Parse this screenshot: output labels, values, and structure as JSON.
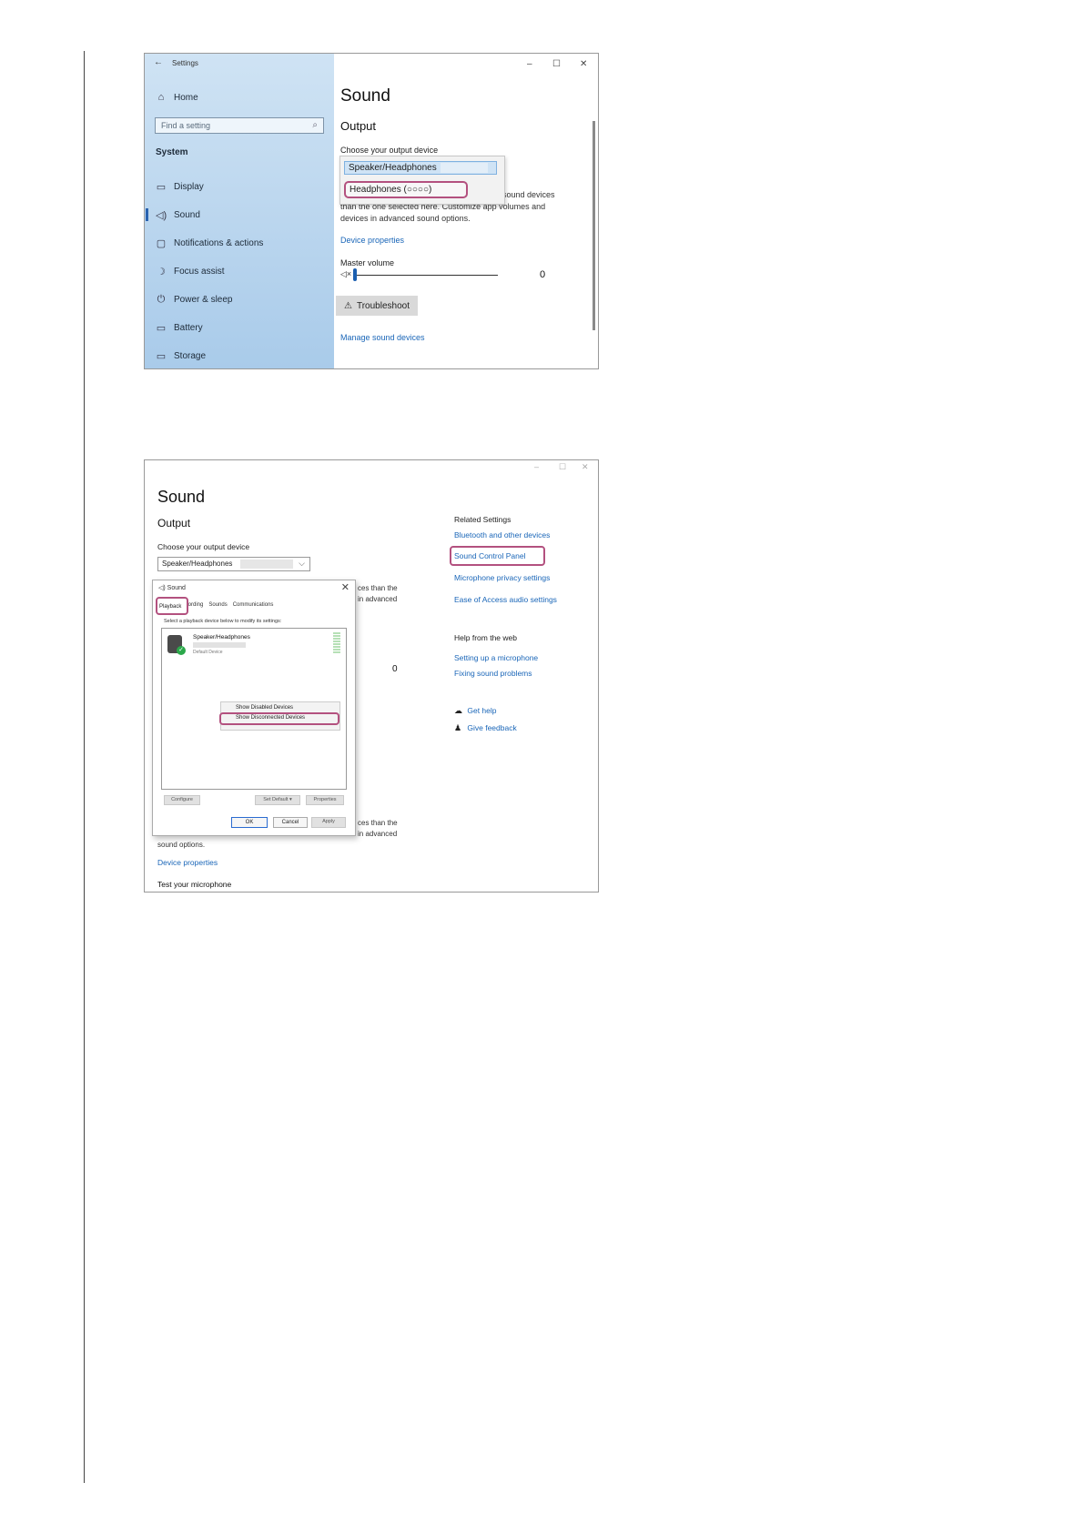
{
  "shot1": {
    "header": {
      "back_icon": "←",
      "title": "Settings",
      "min": "–",
      "max": "☐",
      "close": "✕"
    },
    "sidebar": {
      "home": "Home",
      "search_placeholder": "Find a setting",
      "section": "System",
      "items": [
        {
          "label": "Display",
          "icon": "monitor-icon",
          "glyph": "▭"
        },
        {
          "label": "Sound",
          "icon": "speaker-icon",
          "glyph": "🔈"
        },
        {
          "label": "Notifications & actions",
          "icon": "notification-icon",
          "glyph": "▢"
        },
        {
          "label": "Focus assist",
          "icon": "moon-icon",
          "glyph": "☽"
        },
        {
          "label": "Power & sleep",
          "icon": "power-icon",
          "glyph": "⏻"
        },
        {
          "label": "Battery",
          "icon": "battery-icon",
          "glyph": "▭"
        },
        {
          "label": "Storage",
          "icon": "storage-icon",
          "glyph": "▭"
        }
      ]
    },
    "main": {
      "title": "Sound",
      "output_heading": "Output",
      "choose_label": "Choose your output device",
      "dropdown_options": [
        "Speaker/Headphones",
        "Headphones (○○○○)"
      ],
      "desc_right_1": "t sound devices",
      "desc_line_2a": "than the one selected here. Customize app volumes and",
      "desc_line_3": "devices in advanced sound options.",
      "device_properties": "Device properties",
      "master_volume": "Master volume",
      "volume_value": "0",
      "volume_percent": 0,
      "troubleshoot": "Troubleshoot",
      "manage": "Manage sound devices"
    }
  },
  "shot2": {
    "window": {
      "min": "–",
      "max": "☐",
      "close": "✕"
    },
    "title": "Sound",
    "output_heading": "Output",
    "choose_label": "Choose your output device",
    "combo_value": "Speaker/Headphones",
    "behind_text_1": "ces than the",
    "behind_text_2": "in advanced",
    "behind_value": "0",
    "behind_text_3": "ces than the",
    "behind_text_4": "in advanced",
    "sound_options": "sound options.",
    "device_properties": "Device properties",
    "test_mic": "Test your microphone",
    "related": {
      "heading": "Related Settings",
      "links": [
        "Bluetooth and other devices",
        "Sound Control Panel",
        "Microphone privacy settings",
        "Ease of Access audio settings"
      ]
    },
    "help": {
      "heading": "Help from the web",
      "links": [
        "Setting up a microphone",
        "Fixing sound problems"
      ]
    },
    "get_help": "Get help",
    "give_feedback": "Give feedback",
    "dialog": {
      "title": "Sound",
      "tabs": [
        "Playback",
        "Recording",
        "Sounds",
        "Communications"
      ],
      "hint": "Select a playback device below to modify its settings:",
      "device_name": "Speaker/Headphones",
      "device_status": "Default Device",
      "context_menu": [
        "Show Disabled Devices",
        "Show Disconnected Devices"
      ],
      "buttons": {
        "configure": "Configure",
        "set_default": "Set Default",
        "properties": "Properties",
        "ok": "OK",
        "cancel": "Cancel",
        "apply": "Apply"
      }
    }
  }
}
